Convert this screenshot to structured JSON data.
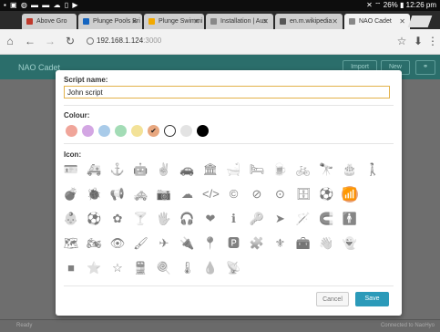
{
  "status_bar": {
    "left_icons": "▪ ▣ ◍ ▬ ▬ ☁ ▯ ▶",
    "right_text": "✕ ⌔ 26% ▮ 12:26 pm"
  },
  "tabs": [
    {
      "label": "Above Gro",
      "favicon_color": "#c0392b"
    },
    {
      "label": "Plunge Pools Bri",
      "favicon_color": "#1565c0"
    },
    {
      "label": "Plunge Swimmi",
      "favicon_color": "#f2a900"
    },
    {
      "label": "Installation | Aus",
      "favicon_color": "#888888"
    },
    {
      "label": "en.m.wikipedia",
      "favicon_color": "#555555"
    },
    {
      "label": "NAO Cadet",
      "favicon_color": "#888888"
    }
  ],
  "toolbar": {
    "url_host": "192.168.1.124",
    "url_port": ":3000",
    "home_icon": "⌂",
    "back_icon": "←",
    "forward_icon": "→",
    "reload_icon": "↻",
    "star_icon": "☆",
    "download_icon": "⬇",
    "menu_icon": "⋮"
  },
  "app": {
    "title": "NAO Cadet",
    "import_label": "Import",
    "new_label": "New",
    "link_icon": "⚭",
    "footer_left": "Ready",
    "footer_right": "Connected to NaoHyo"
  },
  "dialog": {
    "script_name_label": "Script name:",
    "script_name_value": "John script",
    "colour_label": "Colour:",
    "icon_label": "Icon:",
    "cancel_label": "Cancel",
    "save_label": "Save",
    "selected_colour_index": 5,
    "selected_icon_index": 26,
    "colours": [
      "#f0a59a",
      "#d3a6e3",
      "#a9cbe9",
      "#a3dcb6",
      "#f3e298",
      "#e8a77f",
      "#ffffff",
      "#e3e3e3",
      "#000000"
    ],
    "icons": [
      "🪪",
      "🚑",
      "⚓",
      "🤖",
      "✌",
      "🚗",
      "🏛",
      "🛁",
      "🛏",
      "🍺",
      "🚲",
      "🔭",
      "🎂",
      "🚶",
      "💣",
      "🐞",
      "📢",
      "🚕",
      "📷",
      "☁",
      "</>",
      "©",
      "⊘",
      "⊙",
      "🗄",
      "⚽",
      "📶",
      "👶",
      "⚽",
      "✿",
      "🍸",
      "🖐",
      "🎧",
      "❤",
      "ℹ",
      "🔑",
      "➤",
      "🪄",
      "🧲",
      "🚹",
      "🗺",
      "🏍",
      "👁",
      "🖌",
      "✈",
      "🔌",
      "📍",
      "🅿",
      "🧩",
      "⚜",
      "🧰",
      "👋",
      "👻",
      "■",
      "⭐",
      "☆",
      "🚆",
      "🍭",
      "🌡",
      "💧",
      "📡"
    ]
  }
}
